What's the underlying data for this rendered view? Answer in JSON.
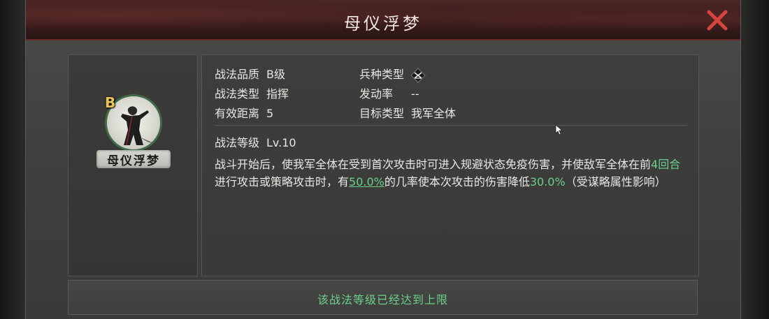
{
  "dialog": {
    "title": "母仪浮梦",
    "close_icon": "close-x-icon",
    "accent_color": "#d6453c"
  },
  "tactic": {
    "grade_badge": "B",
    "name": "母仪浮梦",
    "avatar_icon": "warrior-portrait-icon"
  },
  "info": {
    "quality_label": "战法品质",
    "quality_value": "B级",
    "troop_label": "兵种类型",
    "troop_icon": "troop-type-icon",
    "tactic_type_label": "战法类型",
    "tactic_type_value": "指挥",
    "trigger_rate_label": "发动率",
    "trigger_rate_value": "--",
    "range_label": "有效距离",
    "range_value": "5",
    "target_label": "目标类型",
    "target_value": "我军全体",
    "level_label": "战法等级",
    "level_value": "Lv.10"
  },
  "description": {
    "part1": "战斗开始后，使我军全体在受到首次攻击时可进入规避状态免疫伤害，并使敌军全体在前",
    "rounds": "4回合",
    "part2": "进行攻击或策略攻击时，有",
    "chance": "50.0%",
    "part3": "的几率使本次攻击的伤害降低",
    "reduction": "30.0%",
    "part4": "（受谋略属性影响）",
    "highlight_color": "#6cd08a"
  },
  "footer": {
    "status_text": "该战法等级已经达到上限"
  }
}
